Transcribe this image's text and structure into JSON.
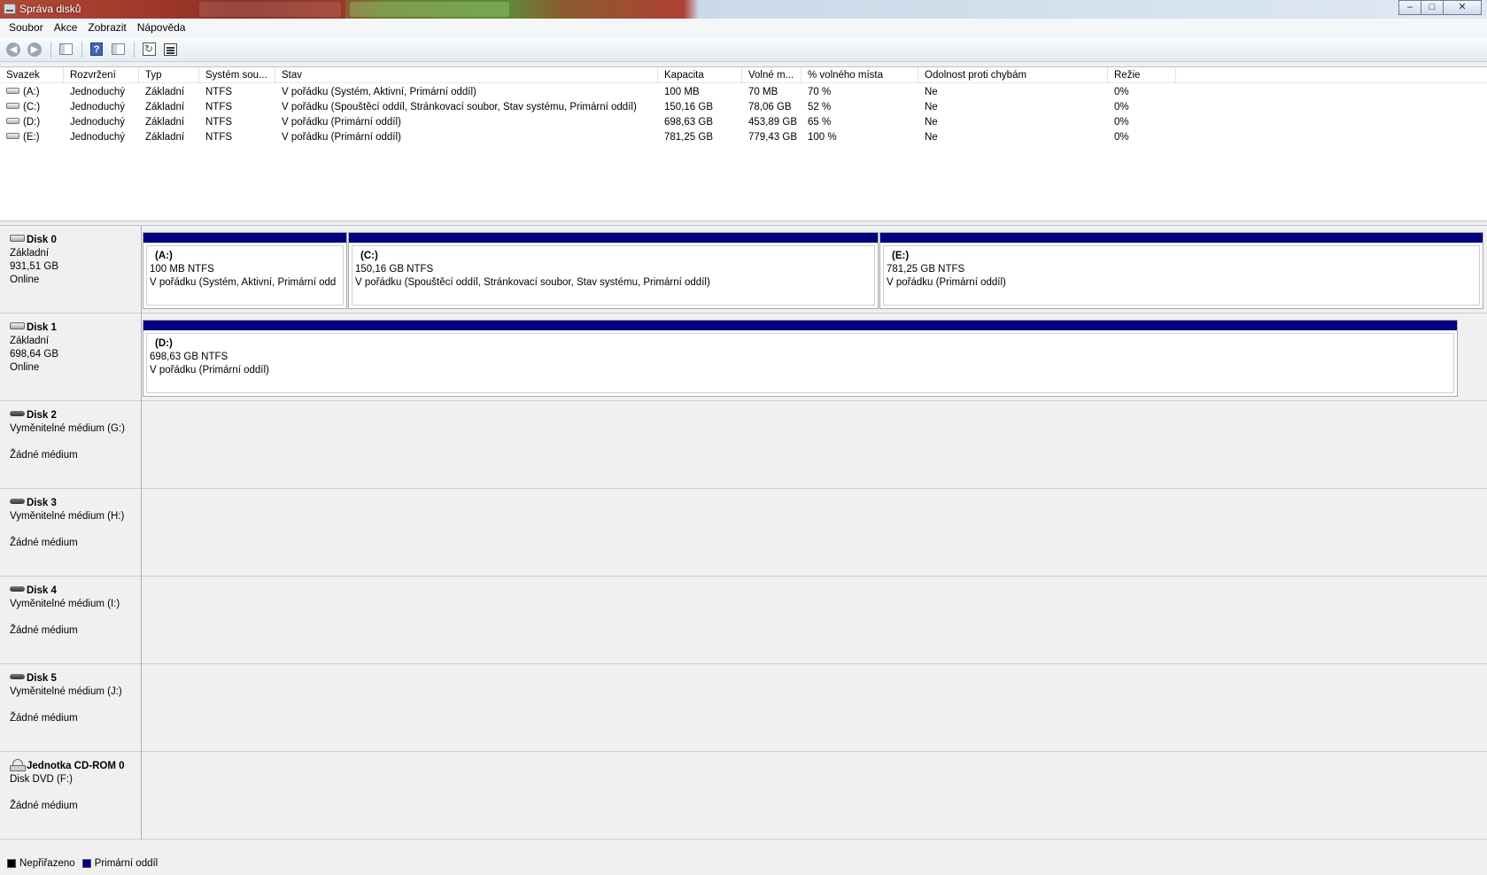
{
  "window": {
    "title": "Správa disků",
    "minimize_symbol": "–",
    "maximize_symbol": "□",
    "close_symbol": "✕"
  },
  "menu": [
    "Soubor",
    "Akce",
    "Zobrazit",
    "Nápověda"
  ],
  "toolbar": {
    "icons": [
      "back-arrow-icon",
      "forward-arrow-icon",
      "show-hide-tree-icon",
      "help-icon",
      "show-hide-action-pane-icon",
      "refresh-icon",
      "properties-icon"
    ],
    "back_glyph": "◀",
    "forward_glyph": "▶",
    "help_glyph": "?",
    "refresh_glyph": "↻"
  },
  "volume_list": {
    "columns": [
      "Svazek",
      "Rozvržení",
      "Typ",
      "Systém sou...",
      "Stav",
      "Kapacita",
      "Volné m...",
      "% volného místa",
      "Odolnost proti chybám",
      "Režie"
    ],
    "rows": [
      {
        "volume": "(A:)",
        "layout": "Jednoduchý",
        "type": "Základní",
        "fs": "NTFS",
        "status": "V pořádku (Systém, Aktivní, Primární oddíl)",
        "capacity": "100 MB",
        "free": "70 MB",
        "pct_free": "70 %",
        "fault": "Ne",
        "overhead": "0%"
      },
      {
        "volume": "(C:)",
        "layout": "Jednoduchý",
        "type": "Základní",
        "fs": "NTFS",
        "status": "V pořádku (Spouštěcí oddíl, Stránkovací soubor, Stav systému, Primární oddíl)",
        "capacity": "150,16 GB",
        "free": "78,06 GB",
        "pct_free": "52 %",
        "fault": "Ne",
        "overhead": "0%"
      },
      {
        "volume": "(D:)",
        "layout": "Jednoduchý",
        "type": "Základní",
        "fs": "NTFS",
        "status": "V pořádku (Primární oddíl)",
        "capacity": "698,63 GB",
        "free": "453,89 GB",
        "pct_free": "65 %",
        "fault": "Ne",
        "overhead": "0%"
      },
      {
        "volume": "(E:)",
        "layout": "Jednoduchý",
        "type": "Základní",
        "fs": "NTFS",
        "status": "V pořádku (Primární oddíl)",
        "capacity": "781,25 GB",
        "free": "779,43 GB",
        "pct_free": "100 %",
        "fault": "Ne",
        "overhead": "0%"
      }
    ]
  },
  "disks": [
    {
      "name": "Disk 0",
      "line1": "Základní",
      "line2": "931,51 GB",
      "line3": "Online",
      "icon": "hard-disk-icon",
      "partitions": [
        {
          "name": "(A:)",
          "size": "100 MB NTFS",
          "status": "V pořádku (Systém, Aktivní, Primární odd"
        },
        {
          "name": "(C:)",
          "size": "150,16 GB NTFS",
          "status": "V pořádku (Spouštěcí oddíl, Stránkovací soubor, Stav systému, Primární oddíl)"
        },
        {
          "name": "(E:)",
          "size": "781,25 GB NTFS",
          "status": "V pořádku (Primární oddíl)"
        }
      ]
    },
    {
      "name": "Disk 1",
      "line1": "Základní",
      "line2": "698,64 GB",
      "line3": "Online",
      "icon": "hard-disk-icon",
      "partitions": [
        {
          "name": "(D:)",
          "size": "698,63 GB NTFS",
          "status": "V pořádku (Primární oddíl)"
        }
      ]
    },
    {
      "name": "Disk 2",
      "line1": "Vyměnitelné médium (G:)",
      "line2": "",
      "line3": "Žádné médium",
      "icon": "removable-disk-icon",
      "partitions": []
    },
    {
      "name": "Disk 3",
      "line1": "Vyměnitelné médium (H:)",
      "line2": "",
      "line3": "Žádné médium",
      "icon": "removable-disk-icon",
      "partitions": []
    },
    {
      "name": "Disk 4",
      "line1": "Vyměnitelné médium (I:)",
      "line2": "",
      "line3": "Žádné médium",
      "icon": "removable-disk-icon",
      "partitions": []
    },
    {
      "name": "Disk 5",
      "line1": "Vyměnitelné médium (J:)",
      "line2": "",
      "line3": "Žádné médium",
      "icon": "removable-disk-icon",
      "partitions": []
    },
    {
      "name": "Jednotka CD-ROM 0",
      "line1": "Disk DVD (F:)",
      "line2": "",
      "line3": "Žádné médium",
      "icon": "cdrom-icon",
      "partitions": []
    }
  ],
  "legend": [
    {
      "label": "Nepřiřazeno",
      "color": "#000000"
    },
    {
      "label": "Primární oddíl",
      "color": "#000080"
    }
  ],
  "colors": {
    "primary_partition": "#000080",
    "unallocated": "#000000"
  }
}
